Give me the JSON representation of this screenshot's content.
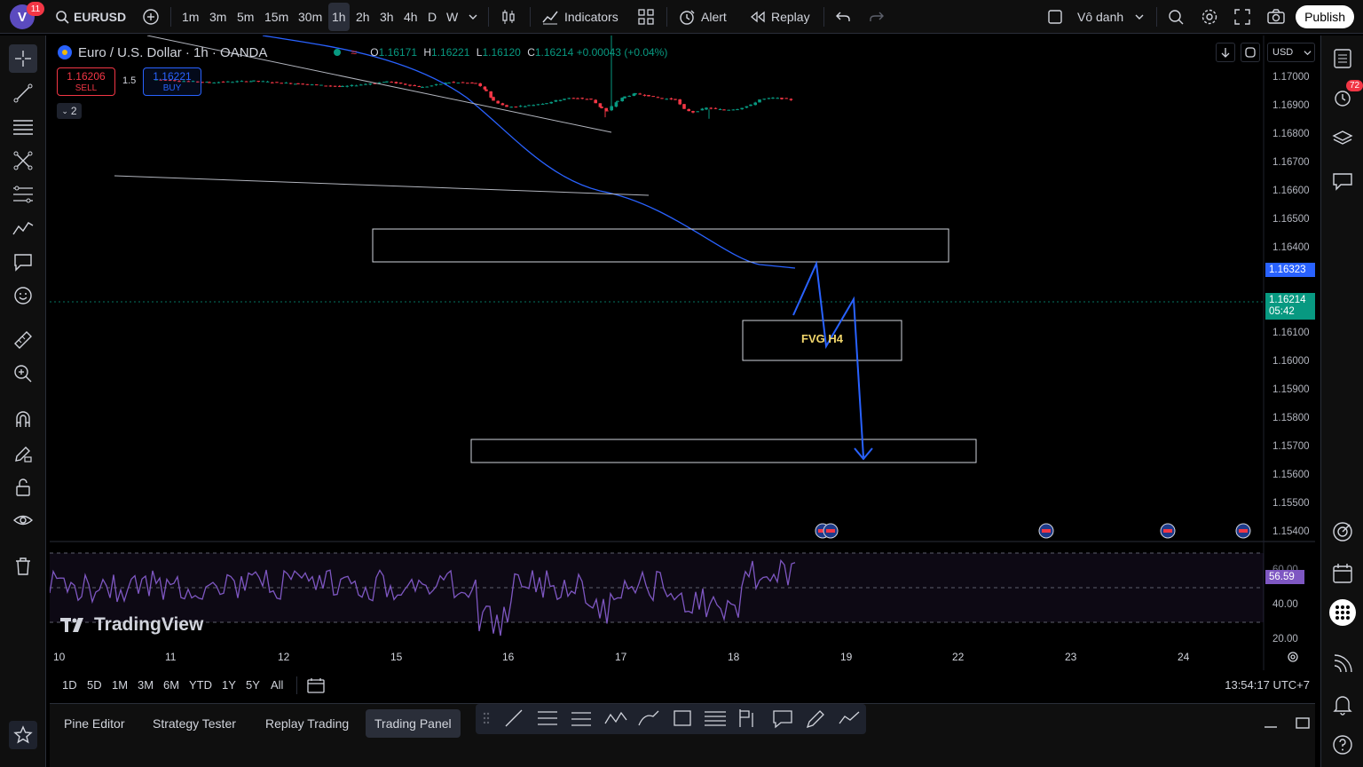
{
  "topbar": {
    "avatar_letter": "V",
    "avatar_badge": "11",
    "symbol": "EURUSD",
    "intervals": [
      "1m",
      "3m",
      "5m",
      "15m",
      "30m",
      "1h",
      "2h",
      "3h",
      "4h",
      "D",
      "W"
    ],
    "active_interval": "1h",
    "indicators_label": "Indicators",
    "alert_label": "Alert",
    "replay_label": "Replay",
    "layout_name": "Vô danh",
    "publish_label": "Publish"
  },
  "chart": {
    "title": "Euro / U.S. Dollar · 1h · OANDA",
    "ohlc": {
      "o_label": "O",
      "o": "1.16171",
      "h_label": "H",
      "h": "1.16221",
      "l_label": "L",
      "l": "1.16120",
      "c_label": "C",
      "c": "1.16214",
      "change": "+0.00043 (+0.04%)"
    },
    "sell_price": "1.16206",
    "sell_label": "SELL",
    "buy_price": "1.16221",
    "buy_label": "BUY",
    "quantity": "1.5",
    "collapse_count": "2",
    "currency": "USD",
    "price_axis": [
      "1.17000",
      "1.16900",
      "1.16800",
      "1.16700",
      "1.16600",
      "1.16500",
      "1.16400",
      "1.16100",
      "1.16000",
      "1.15900",
      "1.15800",
      "1.15700",
      "1.15600",
      "1.15500",
      "1.15400"
    ],
    "ma_price_tag": "1.16323",
    "last_price_tag": "1.16214",
    "countdown": "05:42",
    "rsi_value": "56.59",
    "rsi_axis": [
      "40.00",
      "20.00"
    ],
    "rsi_partial": "60.00",
    "time_axis": [
      "10",
      "11",
      "12",
      "15",
      "16",
      "17",
      "18",
      "19",
      "22",
      "23",
      "24"
    ],
    "annotation": "FVG H4",
    "brand": "TradingView",
    "colors": {
      "up": "#089981",
      "down": "#f23645",
      "ma": "#2962ff",
      "arrow": "#2962ff",
      "rsi": "#7e57c2"
    }
  },
  "rangebar": {
    "ranges": [
      "1D",
      "5D",
      "1M",
      "3M",
      "6M",
      "YTD",
      "1Y",
      "5Y",
      "All"
    ],
    "clock": "13:54:17 UTC+7"
  },
  "bottom": {
    "tabs": [
      "Pine Editor",
      "Strategy Tester",
      "Replay Trading",
      "Trading Panel"
    ],
    "active_tab": "Trading Panel"
  },
  "righttools": {
    "alert_badge": "72"
  }
}
